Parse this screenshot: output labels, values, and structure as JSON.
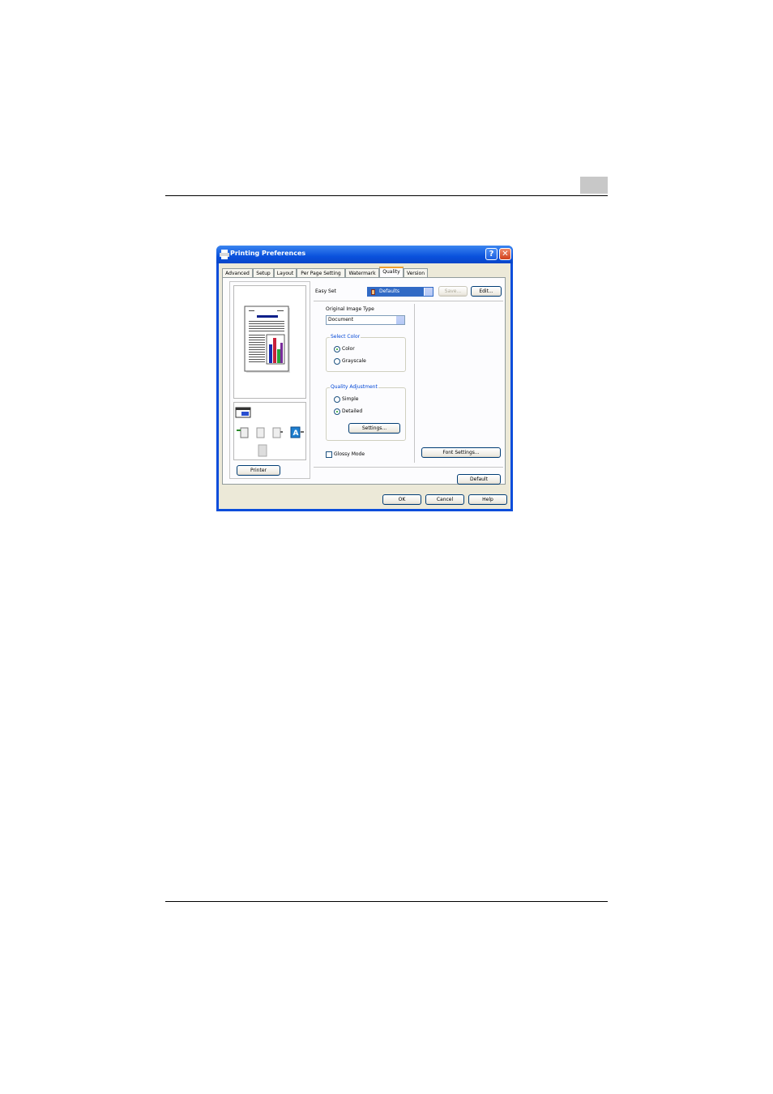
{
  "window": {
    "title": "Printing Preferences",
    "help_glyph": "?",
    "close_glyph": "✕"
  },
  "tabs": [
    {
      "label": "Advanced"
    },
    {
      "label": "Setup"
    },
    {
      "label": "Layout"
    },
    {
      "label": "Per Page Setting"
    },
    {
      "label": "Watermark"
    },
    {
      "label": "Quality",
      "active": true
    },
    {
      "label": "Version"
    }
  ],
  "easy_set": {
    "label": "Easy Set",
    "value": "Defaults",
    "save_label": "Save...",
    "edit_label": "Edit..."
  },
  "original_image_type": {
    "label": "Original Image Type",
    "value": "Document"
  },
  "select_color": {
    "legend": "Select Color",
    "options": [
      {
        "label": "Color",
        "selected": true
      },
      {
        "label": "Grayscale",
        "selected": false
      }
    ]
  },
  "quality_adjustment": {
    "legend": "Quality Adjustment",
    "options": [
      {
        "label": "Simple",
        "selected": false
      },
      {
        "label": "Detailed",
        "selected": true
      }
    ],
    "settings_label": "Settings..."
  },
  "glossy_mode": {
    "label": "Glossy Mode",
    "checked": false
  },
  "font_settings_label": "Font Settings...",
  "default_label": "Default",
  "printer_label": "Printer",
  "footer_buttons": {
    "ok": "OK",
    "cancel": "Cancel",
    "help": "Help"
  },
  "colors": {
    "titlebar": "#0a52dd",
    "dialog_face": "#ece9d8",
    "group_label": "#0046d5",
    "active_tab_accent": "#f0a030"
  }
}
